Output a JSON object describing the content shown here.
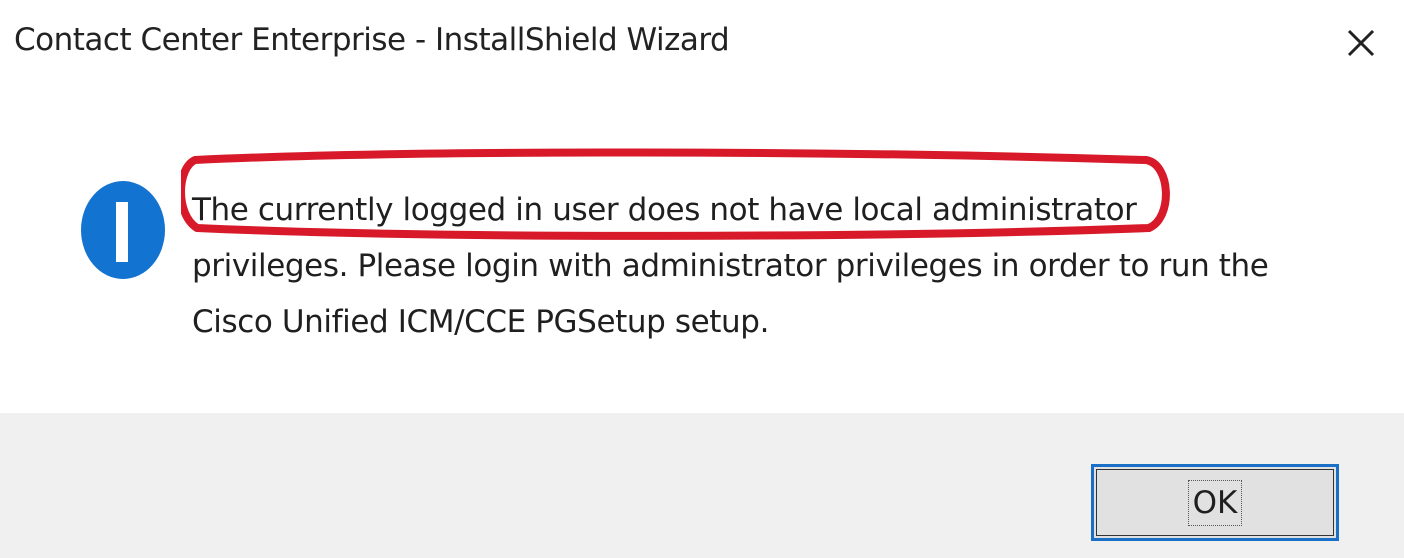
{
  "window": {
    "title": "Contact Center Enterprise - InstallShield Wizard",
    "close_icon": "close-icon"
  },
  "message": {
    "icon": "info-icon",
    "lines": [
      "The currently logged in user does not have local administrator",
      "privileges.  Please login with administrator privileges in order to run the",
      "Cisco Unified ICM/CCE PGSetup setup."
    ],
    "highlight_color": "#d7192a"
  },
  "buttons": {
    "ok_label": "OK"
  },
  "colors": {
    "info_icon": "#1373d1",
    "button_focus_border": "#1a6fc7",
    "footer_background": "#f0f0f0"
  }
}
